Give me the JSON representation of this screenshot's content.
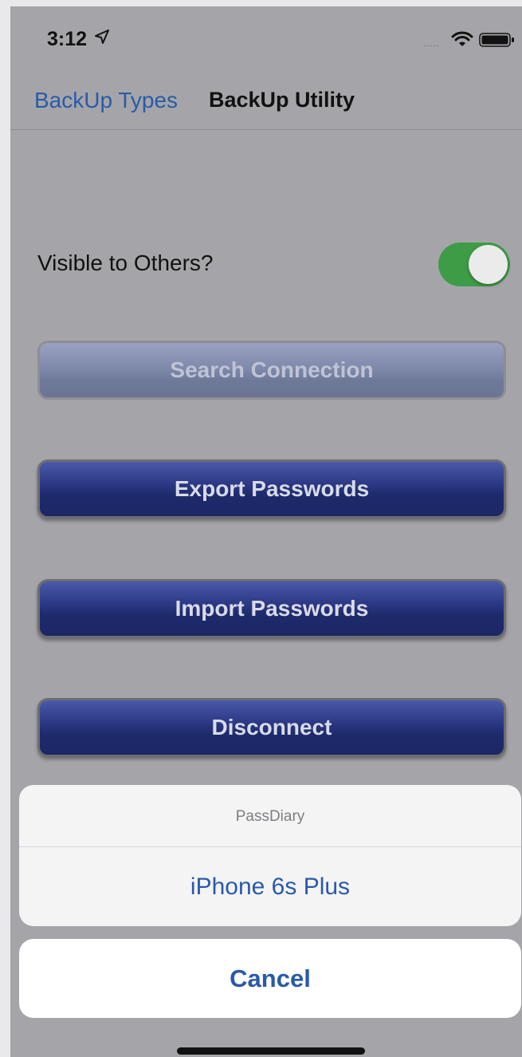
{
  "status_bar": {
    "time": "3:12",
    "signal_dots": "....."
  },
  "nav": {
    "back_label": "BackUp Types",
    "title": "BackUp Utility"
  },
  "settings": {
    "visible_label": "Visible to Others?",
    "visible_on": true
  },
  "buttons": {
    "search": "Search Connection",
    "export": "Export Passwords",
    "import": "Import Passwords",
    "disconnect": "Disconnect"
  },
  "action_sheet": {
    "title": "PassDiary",
    "option": "iPhone 6s Plus",
    "cancel": "Cancel"
  },
  "colors": {
    "accent": "#2a5aa8",
    "toggle_on": "#3e9c47",
    "button_dark": "#2c3986"
  }
}
